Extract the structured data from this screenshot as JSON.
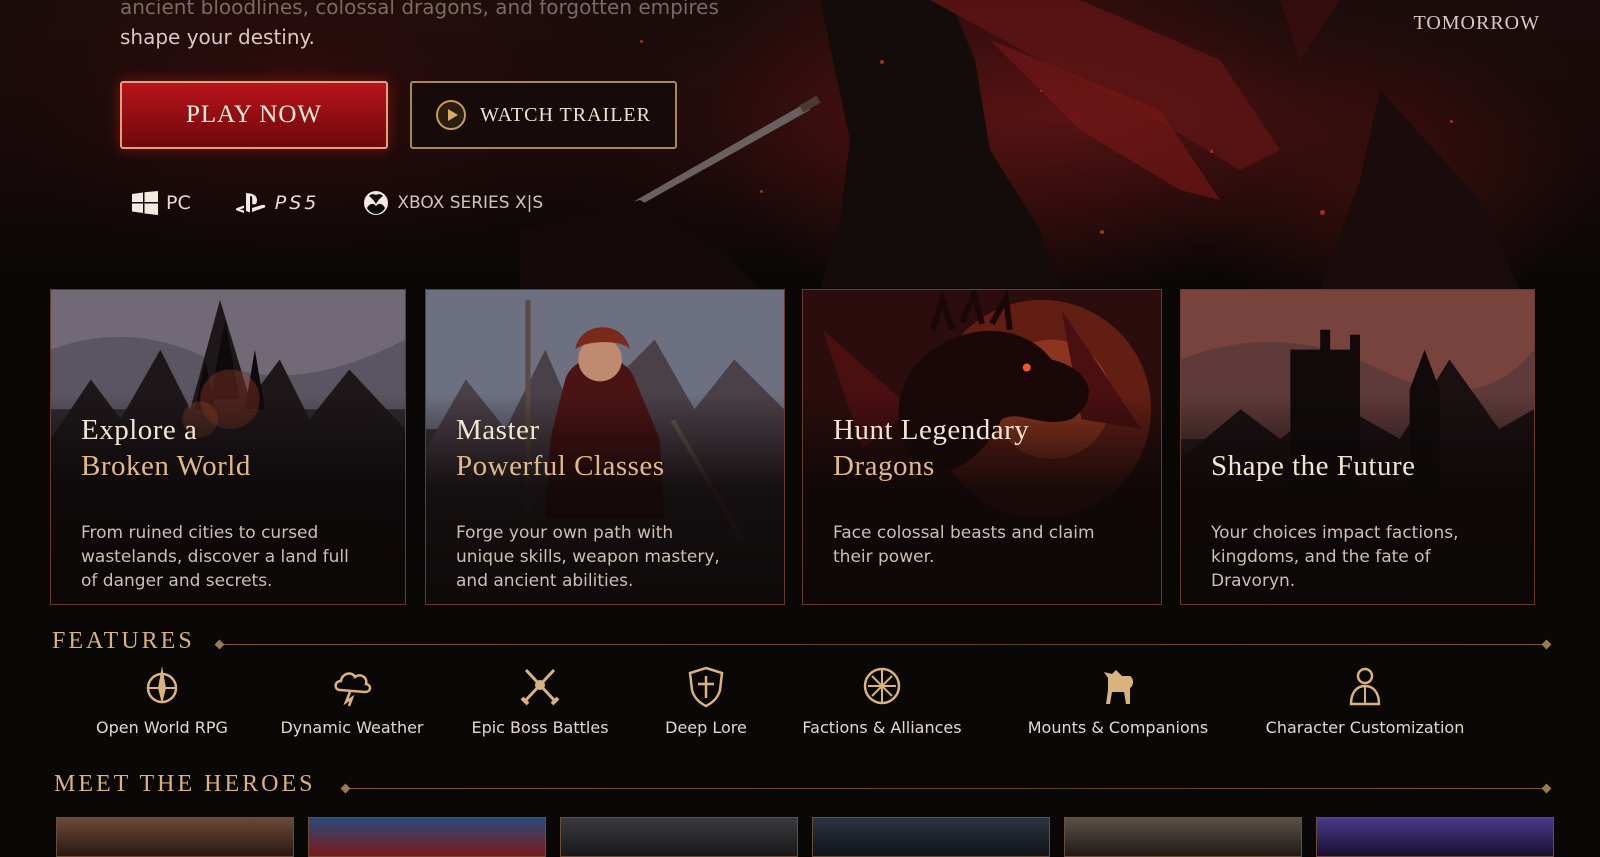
{
  "hero": {
    "tagline_line1": "ancient bloodlines, colossal dragons, and forgotten empires",
    "tagline_line2": "shape your destiny.",
    "tomorrow_label": "TOMORROW",
    "play_button": "PLAY NOW",
    "trailer_button": "WATCH TRAILER",
    "platforms": [
      {
        "label": "PC",
        "icon": "windows-icon"
      },
      {
        "label": "PS5",
        "icon": "playstation-icon"
      },
      {
        "label": "XBOX SERIES X|S",
        "icon": "xbox-icon"
      }
    ]
  },
  "cards": [
    {
      "title_line1": "Explore a",
      "title_line2": "Broken World",
      "body": "From ruined cities to cursed wastelands, discover a land full of danger and secrets."
    },
    {
      "title_line1": "Master",
      "title_line2": "Powerful Classes",
      "body": "Forge your own path with unique skills, weapon mastery, and ancient abilities."
    },
    {
      "title_line1": "Hunt Legendary",
      "title_line2": "Dragons",
      "body": "Face colossal beasts and claim their power."
    },
    {
      "title_line1": "",
      "title_line2": "Shape the Future",
      "body": "Your choices impact factions, kingdoms, and the fate of Dravoryn."
    }
  ],
  "features": {
    "title": "FEATURES",
    "items": [
      {
        "label": "Open World RPG",
        "icon": "compass-icon"
      },
      {
        "label": "Dynamic Weather",
        "icon": "storm-cloud-icon"
      },
      {
        "label": "Epic Boss Battles",
        "icon": "crossed-swords-icon"
      },
      {
        "label": "Deep Lore",
        "icon": "shield-crest-icon"
      },
      {
        "label": "Factions & Alliances",
        "icon": "faction-emblem-icon"
      },
      {
        "label": "Mounts & Companions",
        "icon": "horse-icon"
      },
      {
        "label": "Character Customization",
        "icon": "character-icon"
      }
    ]
  },
  "heroes": {
    "title": "MEET THE HEROES"
  },
  "colors": {
    "accent_red": "#b8141a",
    "gold": "#d9b27e",
    "background": "#0a0707"
  }
}
